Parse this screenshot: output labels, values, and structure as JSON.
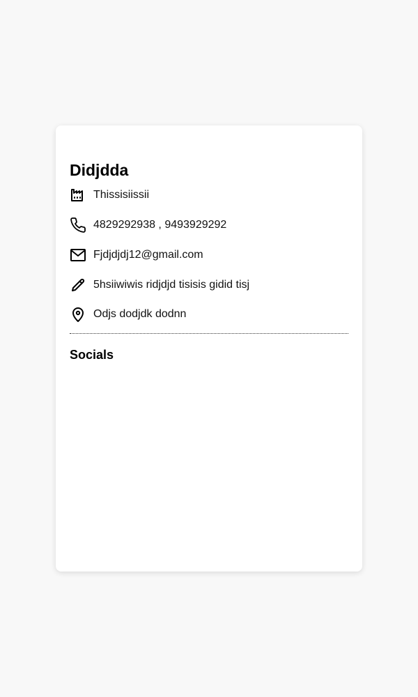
{
  "profile": {
    "name": "Didjdda",
    "company": "Thissisiissii",
    "phone": "4829292938 , 9493929292",
    "email": "Fjdjdjdj12@gmail.com",
    "bio": "5hsiiwiwis ridjdjd tisisis gidid tisj",
    "address": "Odjs dodjdk dodnn"
  },
  "sections": {
    "socials_title": "Socials"
  },
  "icons": {
    "company": "factory-icon",
    "phone": "phone-icon",
    "email": "mail-icon",
    "bio": "pencil-icon",
    "address": "location-pin-icon"
  }
}
